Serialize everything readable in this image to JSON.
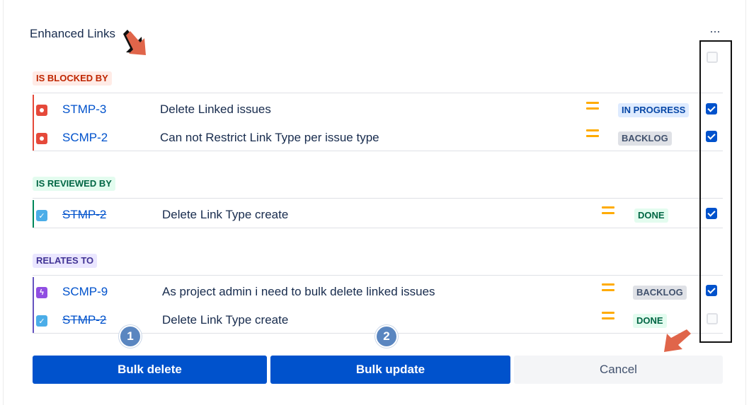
{
  "panel": {
    "title": "Enhanced Links",
    "more_label": "···"
  },
  "groups": [
    {
      "label": "IS BLOCKED BY",
      "color": "#e5493a",
      "rows": [
        {
          "key": "STMP-3",
          "summary": "Delete Linked issues",
          "status": "IN PROGRESS",
          "type": "bug",
          "checked": true,
          "resolved": false
        },
        {
          "key": "SCMP-2",
          "summary": "Can not Restrict Link Type per issue type",
          "status": "BACKLOG",
          "type": "bug",
          "checked": true,
          "resolved": false
        }
      ]
    },
    {
      "label": "IS REVIEWED BY",
      "color": "#00875a",
      "rows": [
        {
          "key": "STMP-2",
          "summary": "Delete Link Type create",
          "status": "DONE",
          "type": "task",
          "checked": true,
          "resolved": true
        }
      ]
    },
    {
      "label": "RELATES TO",
      "color": "#6554c0",
      "rows": [
        {
          "key": "SCMP-9",
          "summary": "As project admin i need to bulk delete linked issues",
          "status": "BACKLOG",
          "type": "epic",
          "checked": true,
          "resolved": false
        },
        {
          "key": "STMP-2",
          "summary": "Delete Link Type create",
          "status": "DONE",
          "type": "task",
          "checked": false,
          "resolved": true
        }
      ]
    }
  ],
  "actions": {
    "bulk_delete": "Bulk delete",
    "bulk_update": "Bulk update",
    "cancel": "Cancel"
  },
  "markers": [
    "1",
    "2"
  ],
  "icons": {
    "bug": "bug-icon",
    "task": "task-icon",
    "epic": "epic-icon",
    "priority": "priority-medium-icon"
  },
  "colors": {
    "primary": "#0052cc",
    "priority": "#ffab00",
    "annotation_arrow": "#e0654a"
  }
}
